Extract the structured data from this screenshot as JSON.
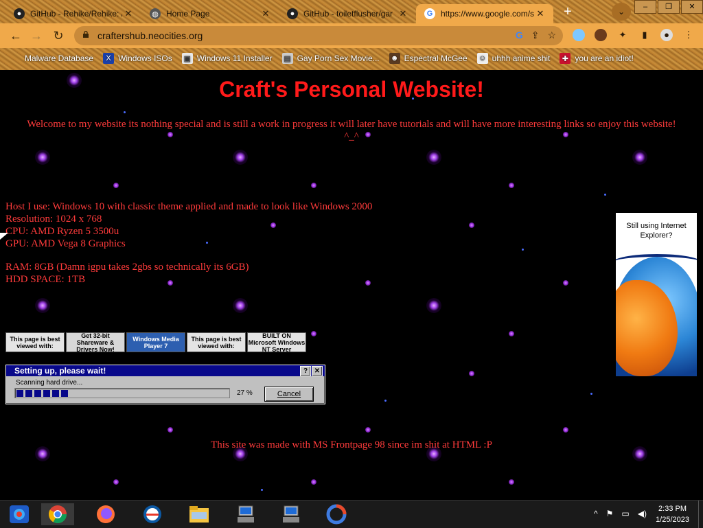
{
  "browser": {
    "tabs": [
      {
        "title": "GitHub - Rehike/Rehike: /",
        "icon": "github-icon",
        "active": false
      },
      {
        "title": "Home Page",
        "icon": "globe-icon",
        "active": false
      },
      {
        "title": "GitHub - toiletflusher/gar",
        "icon": "github-icon",
        "active": false
      },
      {
        "title": "https://www.google.com/s",
        "icon": "google-icon",
        "active": true
      }
    ],
    "new_tab_symbol": "+",
    "tab_menu_symbol": "⌄",
    "window_buttons": [
      "–",
      "❐",
      "✕"
    ],
    "url": "craftershub.neocities.org",
    "bookmarks": [
      {
        "label": "Malware Database"
      },
      {
        "label": "Windows ISOs"
      },
      {
        "label": "Windows 11 Installer"
      },
      {
        "label": "Gay Porn Sex Movie..."
      },
      {
        "label": "Espectral McGee"
      },
      {
        "label": "uhhh anime shit"
      },
      {
        "label": "you are an idiot!"
      }
    ]
  },
  "page": {
    "title": "Craft's Personal Website!",
    "welcome": "Welcome to my website its nothing special and is still a work in progress it will later have tutorials and will have more interesting links so enjoy this website! ^_^",
    "specs": {
      "host": "Host I use: Windows 10 with classic theme applied and made to look like Windows 2000",
      "resolution": "Resolution: 1024 x 768",
      "cpu": "CPU: AMD Ryzen 5 3500u",
      "gpu": "GPU: AMD Vega 8 Graphics",
      "ram": "RAM: 8GB (Damn igpu takes 2gbs so technically its 6GB)",
      "hdd": "HDD SPACE: 1TB"
    },
    "badges": [
      "This page is best viewed with:",
      "Get 32-bit Shareware & Drivers Now!",
      "Windows Media Player 7",
      "This page is best viewed with:",
      "BUILT ON Microsoft Windows NT Server"
    ],
    "dialog": {
      "title": "Setting up, please wait!",
      "help_symbol": "?",
      "close_symbol": "✕",
      "status": "Scanning hard drive...",
      "percent_label": "27 %",
      "progress_fraction": 0.27,
      "cancel_label": "Cancel"
    },
    "footer": "This site was made with MS Frontpage 98 since im shit at HTML :P",
    "ie_ad": {
      "text": "Still using Internet Explorer?"
    }
  },
  "taskbar": {
    "apps": [
      "start-icon",
      "chrome-icon",
      "firefox-icon",
      "edge-icon",
      "file-explorer-icon",
      "installer-icon",
      "installer-icon",
      "app-icon"
    ],
    "tray_symbol": "^",
    "time": "2:33 PM",
    "date": "1/25/2023"
  },
  "colors": {
    "heading": "#ff1a1a",
    "body_text": "#ff3b3b",
    "dialog_title_bar": "#08088a",
    "page_background": "#000000"
  }
}
